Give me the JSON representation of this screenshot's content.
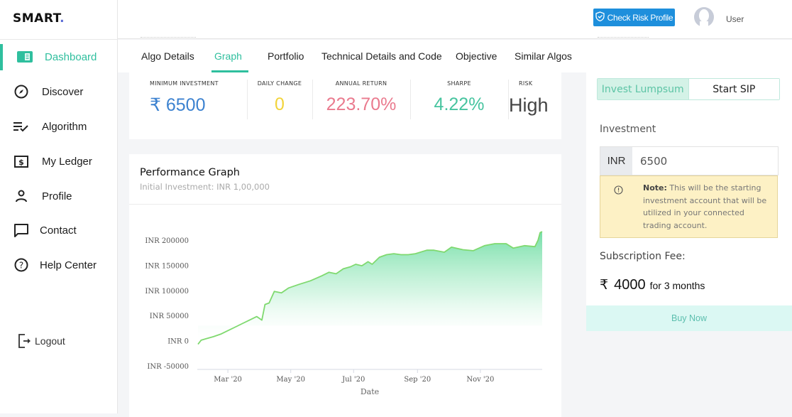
{
  "brand": {
    "name": "SMART",
    "dot": "."
  },
  "sidebar": {
    "items": [
      {
        "label": "Dashboard",
        "icon": "dashboard-icon",
        "active": true
      },
      {
        "label": "Discover",
        "icon": "compass-icon"
      },
      {
        "label": "Algorithm",
        "icon": "list-check-icon"
      },
      {
        "label": "My Ledger",
        "icon": "ledger-dollar-icon"
      },
      {
        "label": "Profile",
        "icon": "user-icon"
      },
      {
        "label": "Contact",
        "icon": "chat-icon"
      },
      {
        "label": "Help Center",
        "icon": "help-circle-icon"
      }
    ],
    "logout": {
      "label": "Logout",
      "icon": "logout-icon"
    }
  },
  "header": {
    "risk_button": "Check Risk Profile",
    "user_name": "User"
  },
  "tabs": [
    {
      "label": "Algo Details"
    },
    {
      "label": "Graph",
      "active": true
    },
    {
      "label": "Portfolio"
    },
    {
      "label": "Technical Details and Code"
    },
    {
      "label": "Objective"
    },
    {
      "label": "Similar Algos"
    }
  ],
  "stats": [
    {
      "label": "MINIMUM INVESTMENT",
      "value": "₹ 6500",
      "color": "#3c82d0"
    },
    {
      "label": "DAILY CHANGE",
      "value": "0",
      "color": "#f2d43a"
    },
    {
      "label": "ANNUAL RETURN",
      "value": "223.70%",
      "color": "#ea7a8e"
    },
    {
      "label": "SHARPE",
      "value": "4.22%",
      "color": "#47c49f"
    },
    {
      "label": "RISK",
      "value": "High",
      "color": "#444444"
    }
  ],
  "graph": {
    "title": "Performance Graph",
    "subtitle": "Initial Investment: INR 1,00,000"
  },
  "chart_data": {
    "type": "area",
    "title": "Performance Graph",
    "subtitle": "Initial Investment: INR 1,00,000",
    "xlabel": "Date",
    "ylabel": "",
    "x_range": [
      "2020-02-01",
      "2020-12-31"
    ],
    "ylim": [
      -50000,
      200000
    ],
    "yticks": [
      -50000,
      0,
      50000,
      100000,
      150000,
      200000
    ],
    "ytick_labels": [
      "INR -50000",
      "INR 0",
      "INR 50000",
      "INR 100000",
      "INR 150000",
      "INR 200000"
    ],
    "xticks": [
      "2020-03-01",
      "2020-05-01",
      "2020-07-01",
      "2020-09-01",
      "2020-11-01"
    ],
    "xtick_labels": [
      "Mar '20",
      "May '20",
      "Jul '20",
      "Sep '20",
      "Nov '20"
    ],
    "grid": false,
    "line_color": "#7fd96f",
    "fill_color": "#5fd99a",
    "series": [
      {
        "name": "Performance",
        "points": [
          [
            "2020-02-01",
            -7000
          ],
          [
            "2020-02-04",
            1000
          ],
          [
            "2020-02-09",
            4000
          ],
          [
            "2020-02-16",
            8000
          ],
          [
            "2020-02-23",
            13000
          ],
          [
            "2020-03-01",
            20000
          ],
          [
            "2020-03-08",
            27000
          ],
          [
            "2020-03-15",
            34000
          ],
          [
            "2020-03-22",
            41000
          ],
          [
            "2020-03-29",
            48000
          ],
          [
            "2020-04-03",
            41000
          ],
          [
            "2020-04-06",
            72000
          ],
          [
            "2020-04-10",
            75000
          ],
          [
            "2020-04-15",
            98000
          ],
          [
            "2020-04-22",
            95000
          ],
          [
            "2020-04-29",
            105000
          ],
          [
            "2020-05-09",
            112000
          ],
          [
            "2020-05-20",
            119000
          ],
          [
            "2020-05-31",
            129000
          ],
          [
            "2020-06-07",
            136000
          ],
          [
            "2020-06-14",
            133000
          ],
          [
            "2020-06-21",
            143000
          ],
          [
            "2020-06-28",
            147000
          ],
          [
            "2020-07-03",
            152000
          ],
          [
            "2020-07-09",
            149000
          ],
          [
            "2020-07-15",
            157000
          ],
          [
            "2020-07-19",
            152000
          ],
          [
            "2020-07-26",
            166000
          ],
          [
            "2020-08-02",
            171000
          ],
          [
            "2020-08-09",
            173000
          ],
          [
            "2020-08-16",
            171000
          ],
          [
            "2020-08-23",
            171000
          ],
          [
            "2020-08-30",
            173000
          ],
          [
            "2020-09-10",
            180000
          ],
          [
            "2020-09-17",
            180000
          ],
          [
            "2020-09-27",
            176000
          ],
          [
            "2020-10-04",
            186000
          ],
          [
            "2020-10-15",
            181000
          ],
          [
            "2020-10-25",
            179000
          ],
          [
            "2020-11-05",
            189000
          ],
          [
            "2020-11-15",
            193000
          ],
          [
            "2020-11-26",
            193000
          ],
          [
            "2020-12-03",
            184000
          ],
          [
            "2020-12-14",
            189000
          ],
          [
            "2020-12-24",
            187000
          ],
          [
            "2020-12-27",
            200000
          ],
          [
            "2020-12-29",
            215000
          ],
          [
            "2020-12-31",
            217000
          ]
        ]
      }
    ]
  },
  "invest_panel": {
    "modes": [
      {
        "label": "Invest Lumpsum",
        "active": true
      },
      {
        "label": "Start SIP"
      }
    ],
    "investment_label": "Investment",
    "currency_prefix": "INR",
    "investment_value": "6500",
    "note_label": "Note:",
    "note_text": "This will be the starting investment account that will be utilized in your connected trading account.",
    "subscription_label": "Subscription Fee:",
    "fee_currency": "₹",
    "fee_amount": "4000",
    "fee_period": "for 3 months",
    "buy_label": "Buy Now"
  }
}
